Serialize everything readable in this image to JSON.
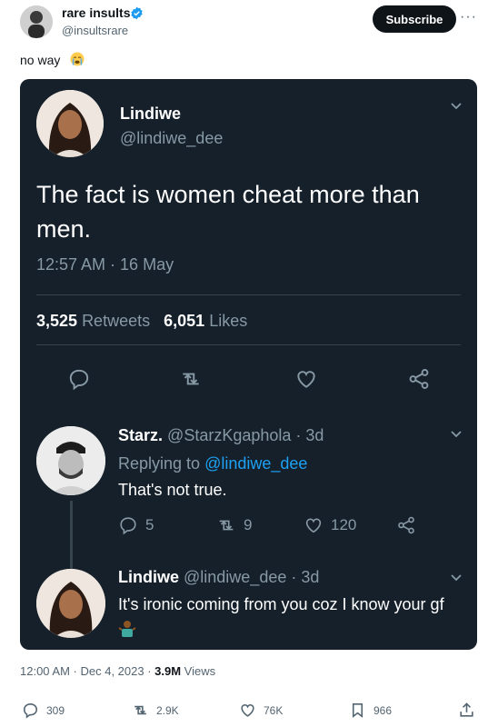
{
  "post": {
    "author_name": "rare insults",
    "author_handle": "@insultsrare",
    "subscribe_label": "Subscribe",
    "more_label": "···",
    "text": "no way",
    "emoji": "crying-face",
    "timestamp": "12:00 AM · Dec 4, 2023 · ",
    "views_count": "3.9M",
    "views_label": " Views",
    "actions": {
      "replies": "309",
      "reposts": "2.9K",
      "likes": "76K",
      "bookmarks": "966"
    }
  },
  "embedded": {
    "tweet": {
      "name": "Lindiwe",
      "handle": "@lindiwe_dee",
      "text": "The fact is women cheat more than men.",
      "time": "12:57 AM · 16 May",
      "retweets_count": "3,525",
      "retweets_label": "Retweets",
      "likes_count": "6,051",
      "likes_label": "Likes"
    },
    "replies": [
      {
        "name": "Starz.",
        "handle": "@StarzKgaphola",
        "age": "· 3d",
        "replying_prefix": "Replying to ",
        "replying_to": "@lindiwe_dee",
        "text": "That's not true.",
        "replies": "5",
        "retweets": "9",
        "likes": "120"
      },
      {
        "name": "Lindiwe",
        "handle": "@lindiwe_dee",
        "age": "· 3d",
        "text": "It's ironic coming from you coz I know your gf",
        "emoji": "person-shrugging"
      }
    ]
  },
  "colors": {
    "verified": "#1d9bf0",
    "card_bg": "#15202b",
    "link": "#1da1f2"
  }
}
